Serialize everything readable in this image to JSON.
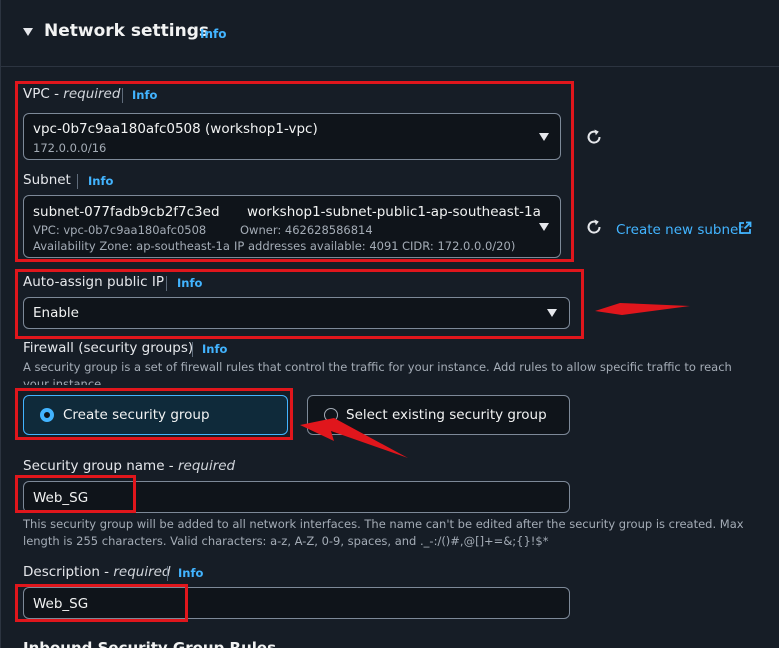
{
  "section": {
    "title": "Network settings",
    "info": "Info"
  },
  "vpc": {
    "label": "VPC - ",
    "required": "required",
    "info": "Info",
    "value": "vpc-0b7c9aa180afc0508 (workshop1-vpc)",
    "cidr": "172.0.0.0/16"
  },
  "subnet": {
    "label": "Subnet",
    "info": "Info",
    "id": "subnet-077fadb9cb2f7c3ed",
    "name": "workshop1-subnet-public1-ap-southeast-1a",
    "vpc_line": "VPC: vpc-0b7c9aa180afc0508",
    "owner": "Owner: 462628586814",
    "az": "Availability Zone: ap-southeast-1a",
    "ips": "IP addresses available: 4091",
    "cidr": "CIDR: 172.0.0.0/20)",
    "create_link": "Create new subnet"
  },
  "auto_assign": {
    "label": "Auto-assign public IP",
    "info": "Info",
    "value": "Enable"
  },
  "firewall": {
    "label": "Firewall (security groups)",
    "info": "Info",
    "description": "A security group is a set of firewall rules that control the traffic for your instance. Add rules to allow specific traffic to reach your instance.",
    "option_create": "Create security group",
    "option_existing": "Select existing security group",
    "selected": "create"
  },
  "sg_name": {
    "label": "Security group name - ",
    "required": "required",
    "value": "Web_SG",
    "hint": "This security group will be added to all network interfaces. The name can't be edited after the security group is created. Max length is 255 characters. Valid characters: a-z, A-Z, 0-9, spaces, and ._-:/()#,@[]+=&;{}!$*"
  },
  "description": {
    "label": "Description - ",
    "required": "required",
    "info": "Info",
    "value": "Web_SG"
  },
  "inbound": {
    "title": "Inbound Security Group Rules"
  },
  "colors": {
    "accent": "#42b4ff",
    "annotation_red": "#e0161c",
    "background": "#161d26",
    "input_bg": "#0f141a"
  }
}
